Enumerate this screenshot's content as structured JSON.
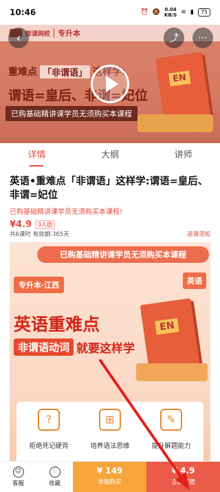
{
  "status_bar": {
    "time": "10:46",
    "net_speed": "0.04",
    "net_unit": "KB/S",
    "battery": "75"
  },
  "banner": {
    "logo_text": "库课网校",
    "logo_sub": "专升本",
    "region_partial": "西",
    "line1_prefix": "重难点",
    "line1_tag": "「非谓语」",
    "line1_suffix": "这样学:",
    "line2": "谓语=皇后、非谓=妃位",
    "line3": "已购基础精讲课学员无须购买本课程",
    "book_label": "EN"
  },
  "tabs": [
    {
      "label": "详情",
      "active": true
    },
    {
      "label": "大纲",
      "active": false
    },
    {
      "label": "讲师",
      "active": false
    }
  ],
  "course": {
    "title": "英语•重难点「非谓语」这样学:谓语=皇后、非谓=妃位",
    "subtitle": "已购基础精讲课学员无须购买本课程!",
    "price": "¥4.9",
    "group_tag": "3人团",
    "meta": "共6课时 有效期:365天",
    "refund": "退课须知"
  },
  "poster": {
    "ribbon": "已购基础精讲课学员无须购买本课程",
    "area": "专升本·江西",
    "subject": "英语",
    "headline": "英语重难点",
    "keyword": "非谓语动词",
    "slogan": "就要这样学",
    "book_label": "EN",
    "features": [
      {
        "icon": "ear-icon",
        "label": "拒绝死记硬背"
      },
      {
        "icon": "presentation-icon",
        "label": "培养语法思维"
      },
      {
        "icon": "certificate-icon",
        "label": "提升解题能力"
      }
    ]
  },
  "bottom_bar": {
    "service_label": "客服",
    "favorite_label": "收藏",
    "buy_price": "¥ 149",
    "buy_label": "单独购买",
    "group_price": "¥ 4.9",
    "group_label": "立即开团"
  },
  "colors": {
    "accent": "#e04a3a",
    "buy_button": "#f7a43a",
    "group_button": "#ec5b49"
  }
}
